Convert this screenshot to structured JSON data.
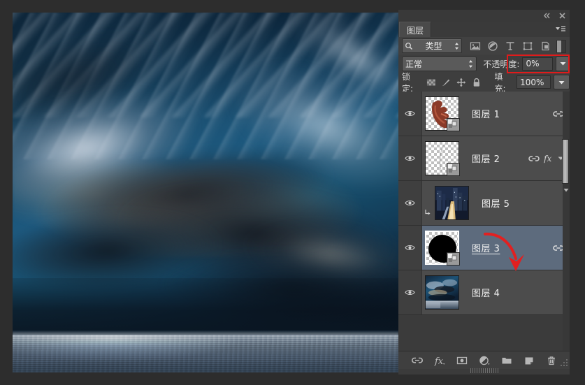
{
  "app": {
    "panel_title": "图层"
  },
  "titlebar": {
    "collapse_icon": "collapse-to-icons-icon",
    "close_icon": "close-icon",
    "menu_icon": "panel-menu-icon"
  },
  "filter": {
    "search_icon": "search-icon",
    "kind_label": "类型",
    "icons": [
      {
        "name": "filter-pixel-icon",
        "title": "像素"
      },
      {
        "name": "filter-adjustment-icon",
        "title": "调整"
      },
      {
        "name": "filter-type-icon",
        "title": "文字"
      },
      {
        "name": "filter-shape-icon",
        "title": "形状"
      },
      {
        "name": "filter-smartobject-icon",
        "title": "智能对象"
      }
    ],
    "toggle_name": "filter-enable-toggle"
  },
  "blend": {
    "mode_label": "正常",
    "opacity_label": "不透明度:",
    "opacity_value": "0%",
    "opacity_arrow_icon": "dropdown-arrow-icon",
    "highlight_color": "#e01b1b"
  },
  "lock": {
    "label": "锁定:",
    "icons": [
      {
        "name": "lock-transparent-pixels-icon"
      },
      {
        "name": "lock-image-pixels-icon"
      },
      {
        "name": "lock-position-icon"
      },
      {
        "name": "lock-all-icon"
      }
    ],
    "fill_label": "填充:",
    "fill_value": "100%",
    "fill_arrow_icon": "dropdown-arrow-icon"
  },
  "layers": [
    {
      "name": "图层 1",
      "visible": true,
      "selected": false,
      "clipped": false,
      "has_link": true,
      "has_fx": false,
      "has_expand": false,
      "thumb": "hand",
      "has_badge": true,
      "thumb_selected": false
    },
    {
      "name": "图层 2",
      "visible": true,
      "selected": false,
      "clipped": false,
      "has_link": true,
      "has_fx": true,
      "has_expand": true,
      "thumb": "curve",
      "has_badge": true,
      "thumb_selected": false
    },
    {
      "name": "图层 5",
      "visible": true,
      "selected": false,
      "clipped": true,
      "has_link": false,
      "has_fx": false,
      "has_expand": false,
      "thumb": "city",
      "has_badge": false,
      "thumb_selected": false
    },
    {
      "name": "图层 3",
      "visible": true,
      "selected": true,
      "clipped": false,
      "has_link": true,
      "has_fx": false,
      "has_expand": false,
      "thumb": "blob",
      "has_badge": true,
      "thumb_selected": true
    },
    {
      "name": "图层 4",
      "visible": true,
      "selected": false,
      "clipped": false,
      "has_link": false,
      "has_fx": false,
      "has_expand": false,
      "thumb": "sky",
      "has_badge": false,
      "thumb_selected": false
    }
  ],
  "bottombar": {
    "icons": [
      {
        "name": "link-layers-icon"
      },
      {
        "name": "layer-style-fx-icon"
      },
      {
        "name": "add-layer-mask-icon"
      },
      {
        "name": "new-adjustment-layer-icon"
      },
      {
        "name": "new-group-icon"
      },
      {
        "name": "new-layer-icon"
      },
      {
        "name": "delete-layer-icon"
      }
    ]
  },
  "annotation": {
    "arrow_name": "red-arrow-annotation",
    "arrow_color": "#e22020"
  },
  "canvas": {
    "image_description": "dramatic sky with clouds over calm ocean"
  }
}
